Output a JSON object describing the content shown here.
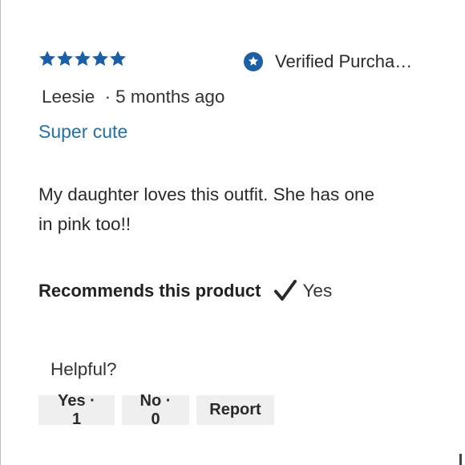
{
  "review": {
    "rating": 5,
    "rating_max": 5,
    "verified_label": "Verified Purcha…",
    "author": "Leesie",
    "separator": "·",
    "time_ago": "5 months ago",
    "title": "Super cute",
    "body": "My daughter loves this outfit. She has one in pink too!!",
    "recommend_label": "Recommends this product",
    "recommend_value": "Yes"
  },
  "helpful": {
    "label": "Helpful?",
    "yes_label": "Yes · 1",
    "no_label": "No · 0",
    "report_label": "Report"
  },
  "colors": {
    "star": "#1b5fa6",
    "title_link": "#2272a6",
    "verified_badge": "#1b5fa6",
    "button_bg": "#efefef"
  },
  "icons": {
    "star": "star-icon",
    "verified": "verified-badge-icon",
    "check": "checkmark-icon"
  }
}
